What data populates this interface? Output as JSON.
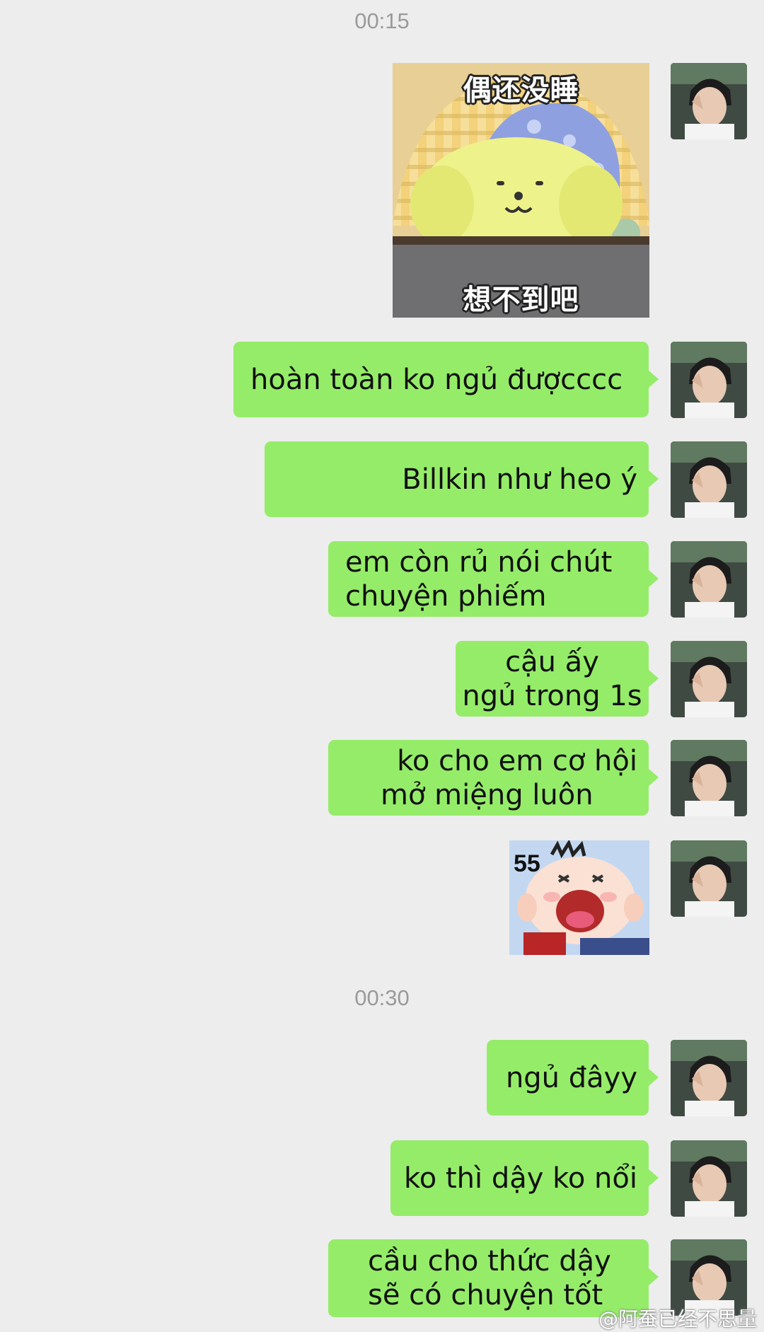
{
  "timestamps": [
    "00:15",
    "00:30"
  ],
  "stickers": {
    "sleep_top_caption": "偶还没睡",
    "sleep_bottom_caption": "想不到吧",
    "cry_label": "55"
  },
  "messages": [
    {
      "lines": [
        "hoàn toàn ko ngủ đượcccc"
      ]
    },
    {
      "lines": [
        "Billkin như heo ý"
      ]
    },
    {
      "lines": [
        "em còn rủ nói chút",
        "chuyện phiếm"
      ]
    },
    {
      "lines": [
        "cậu ấy",
        "ngủ trong 1s"
      ]
    },
    {
      "lines": [
        "ko cho em cơ hội",
        "mở miệng luôn"
      ]
    },
    {
      "lines": [
        "ngủ đâyy"
      ]
    },
    {
      "lines": [
        "ko thì dậy ko nổi"
      ]
    },
    {
      "lines": [
        "cầu cho thức dậy",
        "sẽ có chuyện tốt"
      ]
    }
  ],
  "watermark": "@阿蚕已经不思量",
  "colors": {
    "bubble": "#95ec69",
    "background": "#ededed",
    "timestamp": "#9a9a9a"
  }
}
